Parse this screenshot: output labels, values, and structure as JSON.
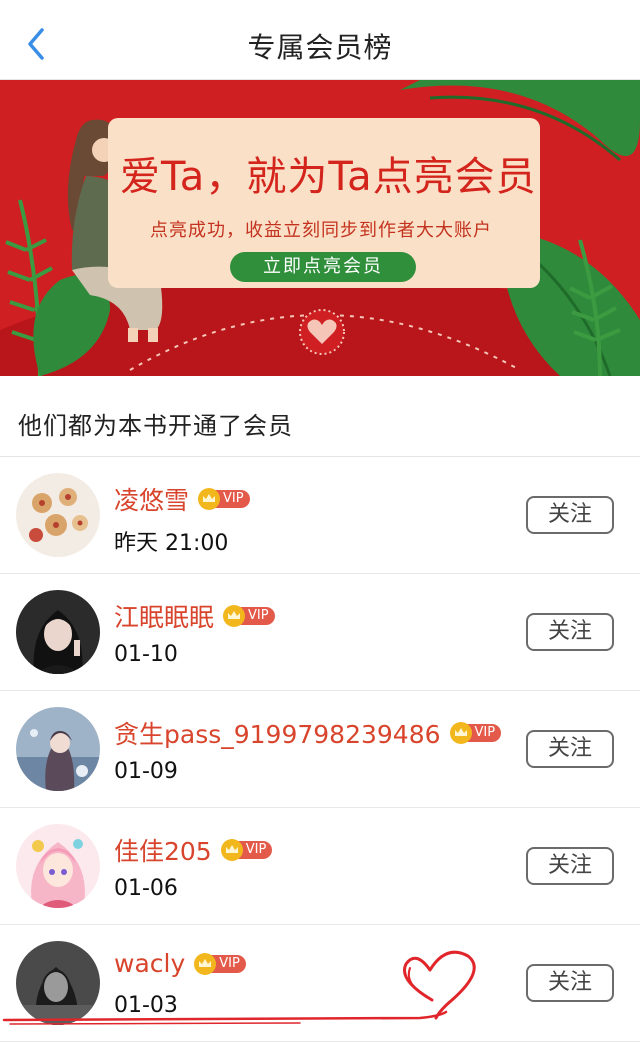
{
  "header": {
    "title": "专属会员榜"
  },
  "banner": {
    "title": "爱Ta，就为Ta点亮会员",
    "subtitle": "点亮成功，收益立刻同步到作者大大账户",
    "cta_label": "立即点亮会员"
  },
  "section": {
    "title": "他们都为本书开通了会员"
  },
  "vip_label": "VIP",
  "follow_label": "关注",
  "members": [
    {
      "name": "凌悠雪",
      "date": "昨天 21:00"
    },
    {
      "name": "江眠眠眠",
      "date": "01-10"
    },
    {
      "name": "贪生pass_9199798239486",
      "date": "01-09"
    },
    {
      "name": "佳佳205",
      "date": "01-06"
    },
    {
      "name": "wacly",
      "date": "01-03"
    }
  ],
  "colors": {
    "accent_blue": "#3a8ee6",
    "name_red": "#d8452c",
    "banner_red": "#cf1f22",
    "cta_green": "#2f8f3a",
    "vip_red": "#e45a4a",
    "crown_gold": "#f3b71e"
  }
}
